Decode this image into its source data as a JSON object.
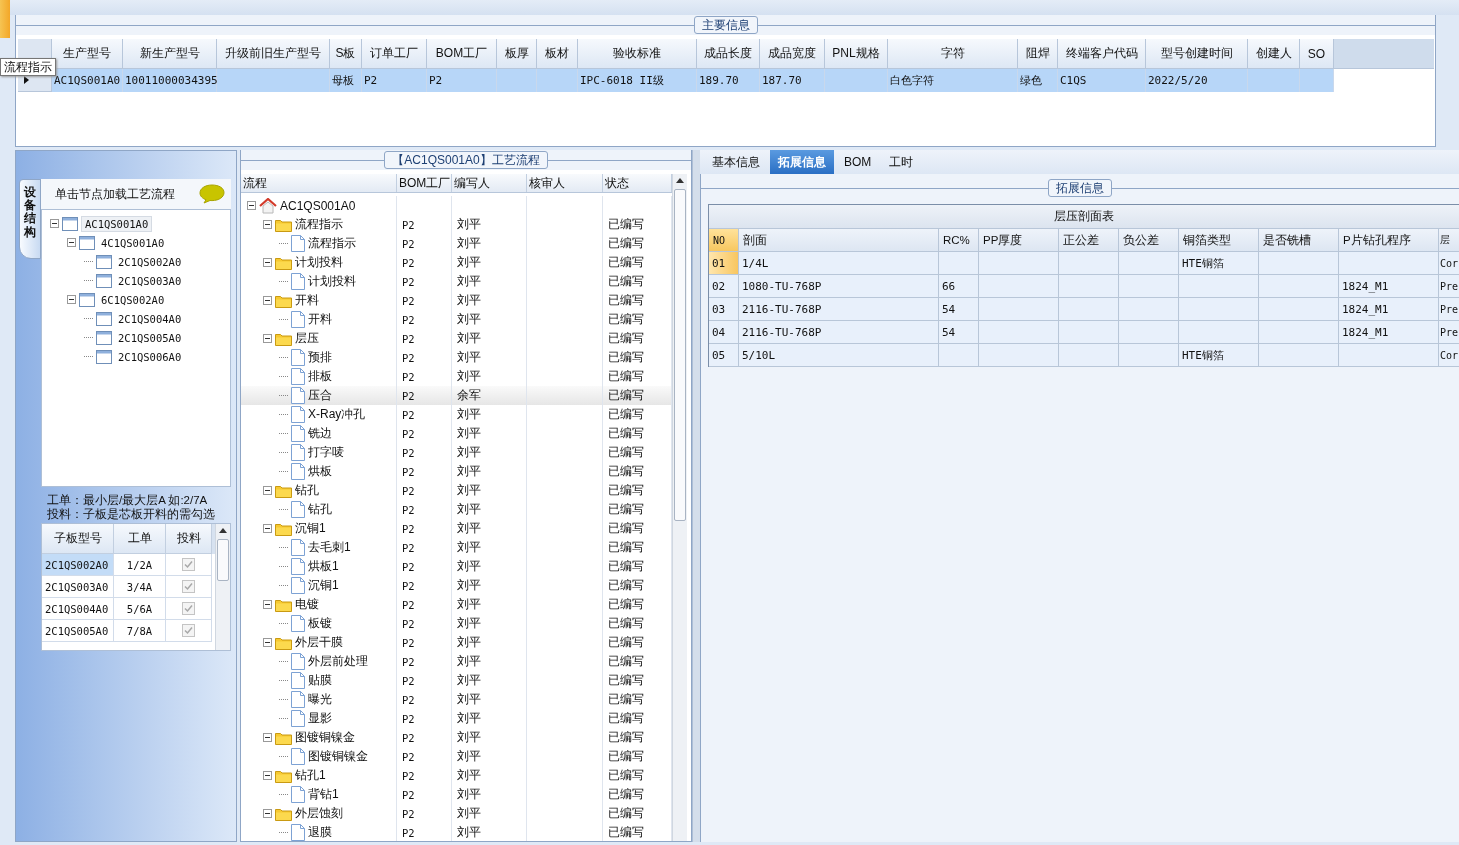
{
  "main_info": {
    "title": "主要信息",
    "columns": [
      "生产型号",
      "新生产型号",
      "升级前旧生产型号",
      "S板",
      "订单工厂",
      "BOM工厂",
      "板厚",
      "板材",
      "验收标准",
      "成品长度",
      "成品宽度",
      "PNL规格",
      "字符",
      "阻焊",
      "终端客户代码",
      "型号创建时间",
      "创建人",
      "SO"
    ],
    "rows": [
      {
        "selected": true,
        "cells": [
          "AC1QS001A0",
          "10011000034395",
          "",
          "母板",
          "P2",
          "P2",
          "",
          "",
          "IPC-6018 II级",
          "189.70",
          "187.70",
          "",
          "白色字符",
          "绿色",
          "C1QS",
          "2022/5/20",
          "",
          ""
        ]
      }
    ]
  },
  "tooltip": "流程指示",
  "device_panel": {
    "tab": "设备结构",
    "hint": "单击节点加载工艺流程",
    "tree": {
      "name": "AC1QS001A0",
      "selected": true,
      "children": [
        {
          "name": "4C1QS001A0",
          "selected": false,
          "children": [
            {
              "name": "2C1QS002A0",
              "selected": false
            },
            {
              "name": "2C1QS003A0",
              "selected": false
            }
          ]
        },
        {
          "name": "6C1QS002A0",
          "selected": false,
          "children": [
            {
              "name": "2C1QS004A0",
              "selected": false
            },
            {
              "name": "2C1QS005A0",
              "selected": false
            },
            {
              "name": "2C1QS006A0",
              "selected": false
            }
          ]
        }
      ]
    },
    "notes": [
      "工单：最小层/最大层A 如:2/7A",
      "投料：子板是芯板开料的需勾选"
    ],
    "grid": {
      "columns": [
        "子板型号",
        "工单",
        "投料"
      ],
      "rows": [
        {
          "board": "2C1QS002A0",
          "order": "1/2A",
          "feed": true,
          "selected": true
        },
        {
          "board": "2C1QS003A0",
          "order": "3/4A",
          "feed": true,
          "selected": false
        },
        {
          "board": "2C1QS004A0",
          "order": "5/6A",
          "feed": true,
          "selected": false
        },
        {
          "board": "2C1QS005A0",
          "order": "7/8A",
          "feed": true,
          "selected": false
        }
      ]
    }
  },
  "process": {
    "title": "【AC1QS001A0】工艺流程",
    "columns": [
      "流程",
      "BOM工厂",
      "编写人",
      "核审人",
      "状态"
    ],
    "root": {
      "name": "AC1QS001A0",
      "kind": "root",
      "selected": false,
      "children": [
        {
          "name": "流程指示",
          "kind": "folder",
          "bom": "P2",
          "author": "刘平",
          "status": "已编写",
          "selected": false,
          "children": [
            {
              "name": "流程指示",
              "kind": "file",
              "bom": "P2",
              "author": "刘平",
              "status": "已编写",
              "selected": false
            }
          ]
        },
        {
          "name": "计划投料",
          "kind": "folder",
          "bom": "P2",
          "author": "刘平",
          "status": "已编写",
          "selected": false,
          "children": [
            {
              "name": "计划投料",
              "kind": "file",
              "bom": "P2",
              "author": "刘平",
              "status": "已编写",
              "selected": false
            }
          ]
        },
        {
          "name": "开料",
          "kind": "folder",
          "bom": "P2",
          "author": "刘平",
          "status": "已编写",
          "selected": false,
          "children": [
            {
              "name": "开料",
              "kind": "file",
              "bom": "P2",
              "author": "刘平",
              "status": "已编写",
              "selected": false
            }
          ]
        },
        {
          "name": "层压",
          "kind": "folder",
          "bom": "P2",
          "author": "刘平",
          "status": "已编写",
          "selected": false,
          "children": [
            {
              "name": "预排",
              "kind": "file",
              "bom": "P2",
              "author": "刘平",
              "status": "已编写",
              "selected": false
            },
            {
              "name": "排板",
              "kind": "file",
              "bom": "P2",
              "author": "刘平",
              "status": "已编写",
              "selected": false
            },
            {
              "name": "压合",
              "kind": "file",
              "bom": "P2",
              "author": "余军",
              "status": "已编写",
              "selected": true
            },
            {
              "name": "X-Ray冲孔",
              "kind": "file",
              "bom": "P2",
              "author": "刘平",
              "status": "已编写",
              "selected": false
            },
            {
              "name": "铣边",
              "kind": "file",
              "bom": "P2",
              "author": "刘平",
              "status": "已编写",
              "selected": false
            },
            {
              "name": "打字唛",
              "kind": "file",
              "bom": "P2",
              "author": "刘平",
              "status": "已编写",
              "selected": false
            },
            {
              "name": "烘板",
              "kind": "file",
              "bom": "P2",
              "author": "刘平",
              "status": "已编写",
              "selected": false
            }
          ]
        },
        {
          "name": "钻孔",
          "kind": "folder",
          "bom": "P2",
          "author": "刘平",
          "status": "已编写",
          "selected": false,
          "children": [
            {
              "name": "钻孔",
              "kind": "file",
              "bom": "P2",
              "author": "刘平",
              "status": "已编写",
              "selected": false
            }
          ]
        },
        {
          "name": "沉铜1",
          "kind": "folder",
          "bom": "P2",
          "author": "刘平",
          "status": "已编写",
          "selected": false,
          "children": [
            {
              "name": "去毛刺1",
              "kind": "file",
              "bom": "P2",
              "author": "刘平",
              "status": "已编写",
              "selected": false
            },
            {
              "name": "烘板1",
              "kind": "file",
              "bom": "P2",
              "author": "刘平",
              "status": "已编写",
              "selected": false
            },
            {
              "name": "沉铜1",
              "kind": "file",
              "bom": "P2",
              "author": "刘平",
              "status": "已编写",
              "selected": false
            }
          ]
        },
        {
          "name": "电镀",
          "kind": "folder",
          "bom": "P2",
          "author": "刘平",
          "status": "已编写",
          "selected": false,
          "children": [
            {
              "name": "板镀",
              "kind": "file",
              "bom": "P2",
              "author": "刘平",
              "status": "已编写",
              "selected": false
            }
          ]
        },
        {
          "name": "外层干膜",
          "kind": "folder",
          "bom": "P2",
          "author": "刘平",
          "status": "已编写",
          "selected": false,
          "children": [
            {
              "name": "外层前处理",
              "kind": "file",
              "bom": "P2",
              "author": "刘平",
              "status": "已编写",
              "selected": false
            },
            {
              "name": "贴膜",
              "kind": "file",
              "bom": "P2",
              "author": "刘平",
              "status": "已编写",
              "selected": false
            },
            {
              "name": "曝光",
              "kind": "file",
              "bom": "P2",
              "author": "刘平",
              "status": "已编写",
              "selected": false
            },
            {
              "name": "显影",
              "kind": "file",
              "bom": "P2",
              "author": "刘平",
              "status": "已编写",
              "selected": false
            }
          ]
        },
        {
          "name": "图镀铜镍金",
          "kind": "folder",
          "bom": "P2",
          "author": "刘平",
          "status": "已编写",
          "selected": false,
          "children": [
            {
              "name": "图镀铜镍金",
              "kind": "file",
              "bom": "P2",
              "author": "刘平",
              "status": "已编写",
              "selected": false
            }
          ]
        },
        {
          "name": "钻孔1",
          "kind": "folder",
          "bom": "P2",
          "author": "刘平",
          "status": "已编写",
          "selected": false,
          "children": [
            {
              "name": "背钻1",
              "kind": "file",
              "bom": "P2",
              "author": "刘平",
              "status": "已编写",
              "selected": false
            }
          ]
        },
        {
          "name": "外层蚀刻",
          "kind": "folder",
          "bom": "P2",
          "author": "刘平",
          "status": "已编写",
          "selected": false,
          "children": [
            {
              "name": "退膜",
              "kind": "file",
              "bom": "P2",
              "author": "刘平",
              "status": "已编写",
              "selected": false
            }
          ]
        }
      ]
    }
  },
  "detail": {
    "tabs": [
      {
        "label": "基本信息",
        "selected": false
      },
      {
        "label": "拓展信息",
        "selected": true
      },
      {
        "label": "BOM",
        "selected": false
      },
      {
        "label": "工时",
        "selected": false
      }
    ],
    "group_title": "拓展信息",
    "table": {
      "title": "层压剖面表",
      "columns": [
        "NO",
        "剖面",
        "RC%",
        "PP厚度",
        "正公差",
        "负公差",
        "铜箔类型",
        "是否铣槽",
        "P片钻孔程序",
        "层"
      ],
      "rows": [
        {
          "selected": true,
          "cells": [
            "01",
            "1/4L",
            "",
            "",
            "",
            "",
            "HTE铜箔",
            "",
            "",
            "Cor"
          ]
        },
        {
          "selected": false,
          "cells": [
            "02",
            "1080-TU-768P",
            "66",
            "",
            "",
            "",
            "",
            "",
            "1824_M1",
            "Pre"
          ]
        },
        {
          "selected": false,
          "cells": [
            "03",
            "2116-TU-768P",
            "54",
            "",
            "",
            "",
            "",
            "",
            "1824_M1",
            "Pre"
          ]
        },
        {
          "selected": false,
          "cells": [
            "04",
            "2116-TU-768P",
            "54",
            "",
            "",
            "",
            "",
            "",
            "1824_M1",
            "Pre"
          ]
        },
        {
          "selected": false,
          "cells": [
            "05",
            "5/10L",
            "",
            "",
            "",
            "",
            "HTE铜箔",
            "",
            "",
            "Cor"
          ]
        }
      ]
    }
  }
}
